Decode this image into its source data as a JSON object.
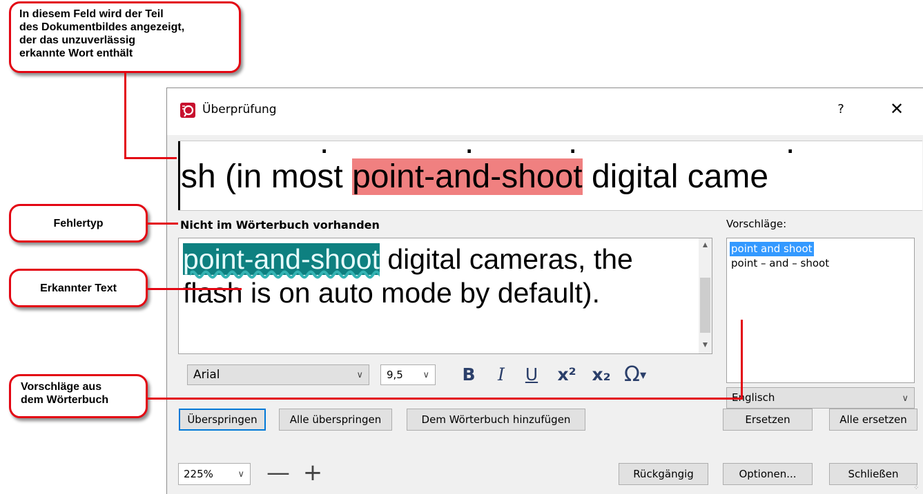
{
  "annotations": {
    "top": [
      "In diesem Feld wird der Teil",
      "des Dokumentbildes angezeigt,",
      "der das unzuverlässig",
      "erkannte Wort enthält"
    ],
    "error_type": "Fehlertyp",
    "recognized_text": "Erkannter Text",
    "suggestions": [
      "Vorschläge aus",
      "dem Wörterbuch"
    ],
    "accent_color": "#e30613"
  },
  "dialog": {
    "title": "Überprüfung",
    "icon": "app-logo-icon",
    "help_label": "?",
    "close_label": "✕"
  },
  "image_strip": {
    "before": "sh (in most ",
    "highlight": "point-and-shoot",
    "after": " digital came",
    "highlight_color": "#f08080"
  },
  "error_type": "Nicht im Wörterbuch vorhanden",
  "editor": {
    "word": "point-and-shoot",
    "rest": " digital cameras, the flash is on auto mode by default).",
    "highlight_color": "#0e8080"
  },
  "suggestions": {
    "label": "Vorschläge:",
    "items": [
      "point and shoot",
      "point – and – shoot"
    ],
    "selected_index": 0
  },
  "format": {
    "font": "Arial",
    "size": "9,5",
    "bold": "B",
    "italic": "I",
    "underline": "U",
    "superscript": "x²",
    "subscript": "x₂",
    "special_chars": "Ω"
  },
  "language": "Englisch",
  "buttons": {
    "skip": "Überspringen",
    "skip_all": "Alle überspringen",
    "add_to_dictionary": "Dem Wörterbuch hinzufügen",
    "replace": "Ersetzen",
    "replace_all": "Alle ersetzen",
    "undo": "Rückgängig",
    "options": "Optionen...",
    "close": "Schließen"
  },
  "zoom": {
    "value": "225%",
    "minus": "—",
    "plus": "+"
  }
}
